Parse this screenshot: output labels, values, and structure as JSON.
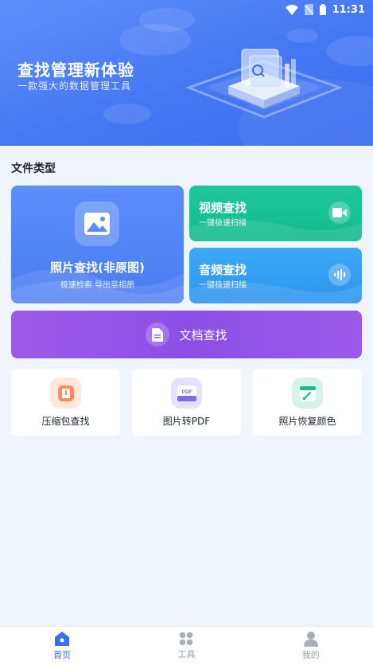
{
  "status_bar": {
    "time": "11:31"
  },
  "hero": {
    "title": "查找管理新体验",
    "subtitle": "一款强大的数据管理工具"
  },
  "section": {
    "title": "文件类型"
  },
  "cards": {
    "photo": {
      "title": "照片查找(非原图)",
      "subtitle": "极速检索 导出至相册",
      "icon": "image-icon"
    },
    "video": {
      "title": "视频查找",
      "subtitle": "一键极速扫描",
      "icon": "video-camera-icon"
    },
    "audio": {
      "title": "音频查找",
      "subtitle": "一键极速扫描",
      "icon": "sound-wave-icon"
    },
    "document": {
      "title": "文档查找",
      "icon": "document-icon"
    }
  },
  "tools": [
    {
      "label": "压缩包查找",
      "icon": "zip-icon",
      "color": "#ff7a45"
    },
    {
      "label": "图片转PDF",
      "icon": "pdf-icon",
      "color": "#7b6cf2",
      "icon_text": "PDF"
    },
    {
      "label": "照片恢复颜色",
      "icon": "color-restore-icon",
      "color": "#1fba8a"
    }
  ],
  "tabbar": {
    "items": [
      {
        "label": "首页",
        "icon": "home-icon",
        "active": true
      },
      {
        "label": "工具",
        "icon": "grid-icon",
        "active": false
      },
      {
        "label": "我的",
        "icon": "user-icon",
        "active": false
      }
    ]
  },
  "colors": {
    "accent": "#3d6ef1",
    "photo_card": "#4a7cf2",
    "video_card": "#14b98a",
    "audio_card": "#2f95ef",
    "document_card": "#8c4ee6"
  }
}
